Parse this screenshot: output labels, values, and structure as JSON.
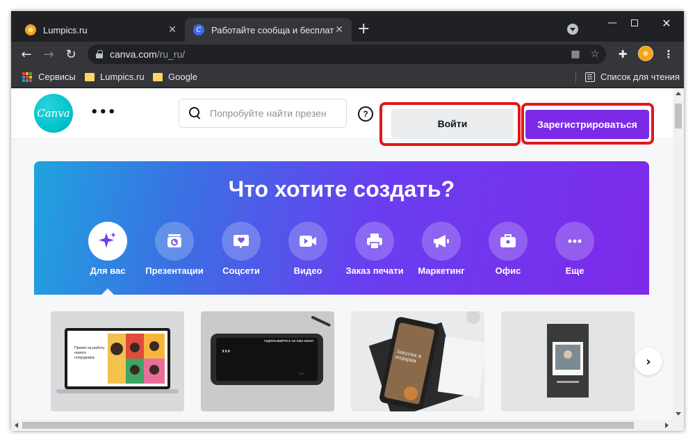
{
  "tabs": [
    {
      "title": "Lumpics.ru",
      "favicon_color": "#f7a21b"
    },
    {
      "title": "Работайте сообща и бесплатно",
      "favicon_color": "#3d6ae8",
      "favicon_letter": "C"
    }
  ],
  "omnibox": {
    "host": "canva.com",
    "path": "/ru_ru/"
  },
  "bookmarks": {
    "services": "Сервисы",
    "items": [
      "Lumpics.ru",
      "Google"
    ],
    "reading_list": "Список для чтения"
  },
  "canva": {
    "logo_text": "Canva",
    "search_placeholder": "Попробуйте найти презен",
    "help_glyph": "?",
    "login_label": "Войти",
    "signup_label": "Зарегистрироваться",
    "accent_color": "#7d2ae8",
    "highlight_color": "#e0161a"
  },
  "hero": {
    "title": "Что хотите создать?",
    "categories": [
      {
        "label": "Для вас",
        "icon": "sparkle-icon",
        "active": true
      },
      {
        "label": "Презентации",
        "icon": "presentation-icon",
        "active": false
      },
      {
        "label": "Соцсети",
        "icon": "heart-chat-icon",
        "active": false
      },
      {
        "label": "Видео",
        "icon": "video-camera-icon",
        "active": false
      },
      {
        "label": "Заказ печати",
        "icon": "printer-icon",
        "active": false
      },
      {
        "label": "Маркетинг",
        "icon": "megaphone-icon",
        "active": false
      },
      {
        "label": "Офис",
        "icon": "briefcase-icon",
        "active": false
      },
      {
        "label": "Еще",
        "icon": "more-icon",
        "active": false
      }
    ]
  },
  "cards": {
    "card1": {
      "headline": "Прием на работу нового сотрудника"
    },
    "card2": {
      "headline": "подписывайтесь на наш канал"
    },
    "card3": {
      "headline": "Закуски и подарки"
    }
  }
}
